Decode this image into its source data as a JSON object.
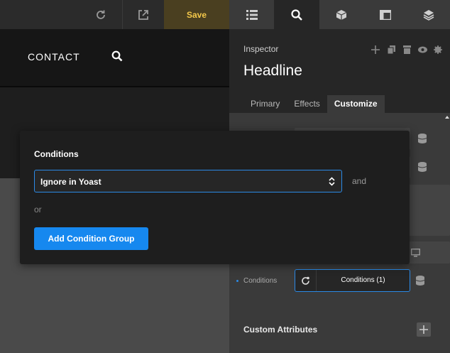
{
  "toolbar": {
    "save_label": "Save",
    "accent": "#f4c84a"
  },
  "canvas": {
    "nav_contact": "CONTACT"
  },
  "inspector": {
    "label": "Inspector",
    "title": "Headline",
    "tabs": [
      {
        "label": "Primary",
        "active": false
      },
      {
        "label": "Effects",
        "active": false
      },
      {
        "label": "Customize",
        "active": true
      }
    ],
    "conditions_label": "Conditions",
    "conditions_value": "Conditions (1)",
    "custom_attributes_label": "Custom Attributes"
  },
  "modal": {
    "title": "Conditions",
    "select_value": "Ignore in Yoast",
    "and_label": "and",
    "or_label": "or",
    "add_button_label": "Add Condition Group",
    "accent": "#1688ef"
  }
}
